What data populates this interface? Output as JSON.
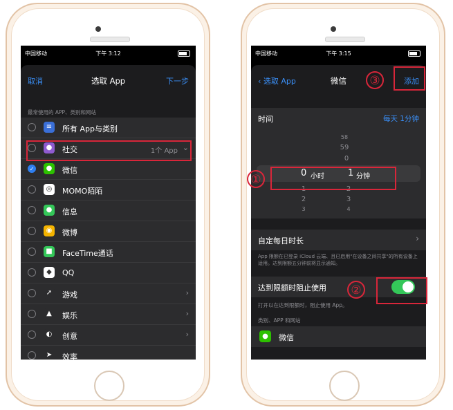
{
  "left_phone": {
    "status": {
      "carrier": "中国移动",
      "time": "下午 3:12"
    },
    "nav": {
      "cancel": "取消",
      "title": "选取 App",
      "next": "下一步"
    },
    "section_label": "最常使用的 APP、类别和网站",
    "rows": [
      {
        "label": "所有 App与类别",
        "checked": false,
        "icon": "stack-icon",
        "color": "#3a6fd8"
      },
      {
        "label": "社交",
        "detail": "1个 App",
        "chevron": "⌄",
        "checked": false,
        "icon": "social-bubble-icon",
        "color": "#8f5bd0"
      },
      {
        "label": "微信",
        "checked": true,
        "icon": "wechat-icon",
        "color": "#2dc100"
      },
      {
        "label": "MOMO陌陌",
        "checked": false,
        "icon": "momo-icon",
        "color": "#ffffff"
      },
      {
        "label": "信息",
        "checked": false,
        "icon": "messages-icon",
        "color": "#34c759"
      },
      {
        "label": "微博",
        "checked": false,
        "icon": "weibo-icon",
        "color": "#f5b400"
      },
      {
        "label": "FaceTime通话",
        "checked": false,
        "icon": "facetime-icon",
        "color": "#34c759"
      },
      {
        "label": "QQ",
        "checked": false,
        "icon": "qq-icon",
        "color": "#ffffff"
      },
      {
        "label": "游戏",
        "chevron": "›",
        "checked": false,
        "icon": "rocket-icon",
        "color": "#2c2c2e"
      },
      {
        "label": "娱乐",
        "chevron": "›",
        "checked": false,
        "icon": "popcorn-icon",
        "color": "#2c2c2e"
      },
      {
        "label": "创意",
        "chevron": "›",
        "checked": false,
        "icon": "palette-icon",
        "color": "#2c2c2e"
      },
      {
        "label": "效率",
        "checked": false,
        "icon": "plane-icon",
        "color": "#2c2c2e"
      }
    ]
  },
  "right_phone": {
    "status": {
      "carrier": "中国移动",
      "time": "下午 3:15"
    },
    "nav": {
      "back": "选取 App",
      "title": "微信",
      "add": "添加"
    },
    "time_row": {
      "label": "时间",
      "value": "每天 1分钟"
    },
    "picker": {
      "hours_above": [
        "58",
        "59"
      ],
      "hours_label": "0",
      "hours_unit": "小时",
      "hours_below": [
        "1",
        "2",
        "3"
      ],
      "minutes_above": [
        "0"
      ],
      "minutes_label": "1",
      "minutes_unit": "分钟",
      "minutes_below": [
        "2",
        "3",
        "4"
      ]
    },
    "custom_row": {
      "label": "自定每日时长"
    },
    "footnote": "App 限额在已登录 iCloud 云端、且已启用\"在设备之间共享\"的所有设备上适用。达到限额五分钟前将显示通知。",
    "block_row": {
      "label": "达到限额时阻止使用",
      "toggle_on": true
    },
    "block_note": "打开以在达到限额时，阻止使用 App。",
    "apps_label": "类别、APP 和网站",
    "app_row": {
      "label": "微信"
    }
  },
  "annotations": {
    "one": "①",
    "two": "②",
    "three": "③"
  },
  "colors": {
    "accent": "#3a8ef5",
    "highlight": "#d9263a",
    "toggle": "#34c759"
  }
}
